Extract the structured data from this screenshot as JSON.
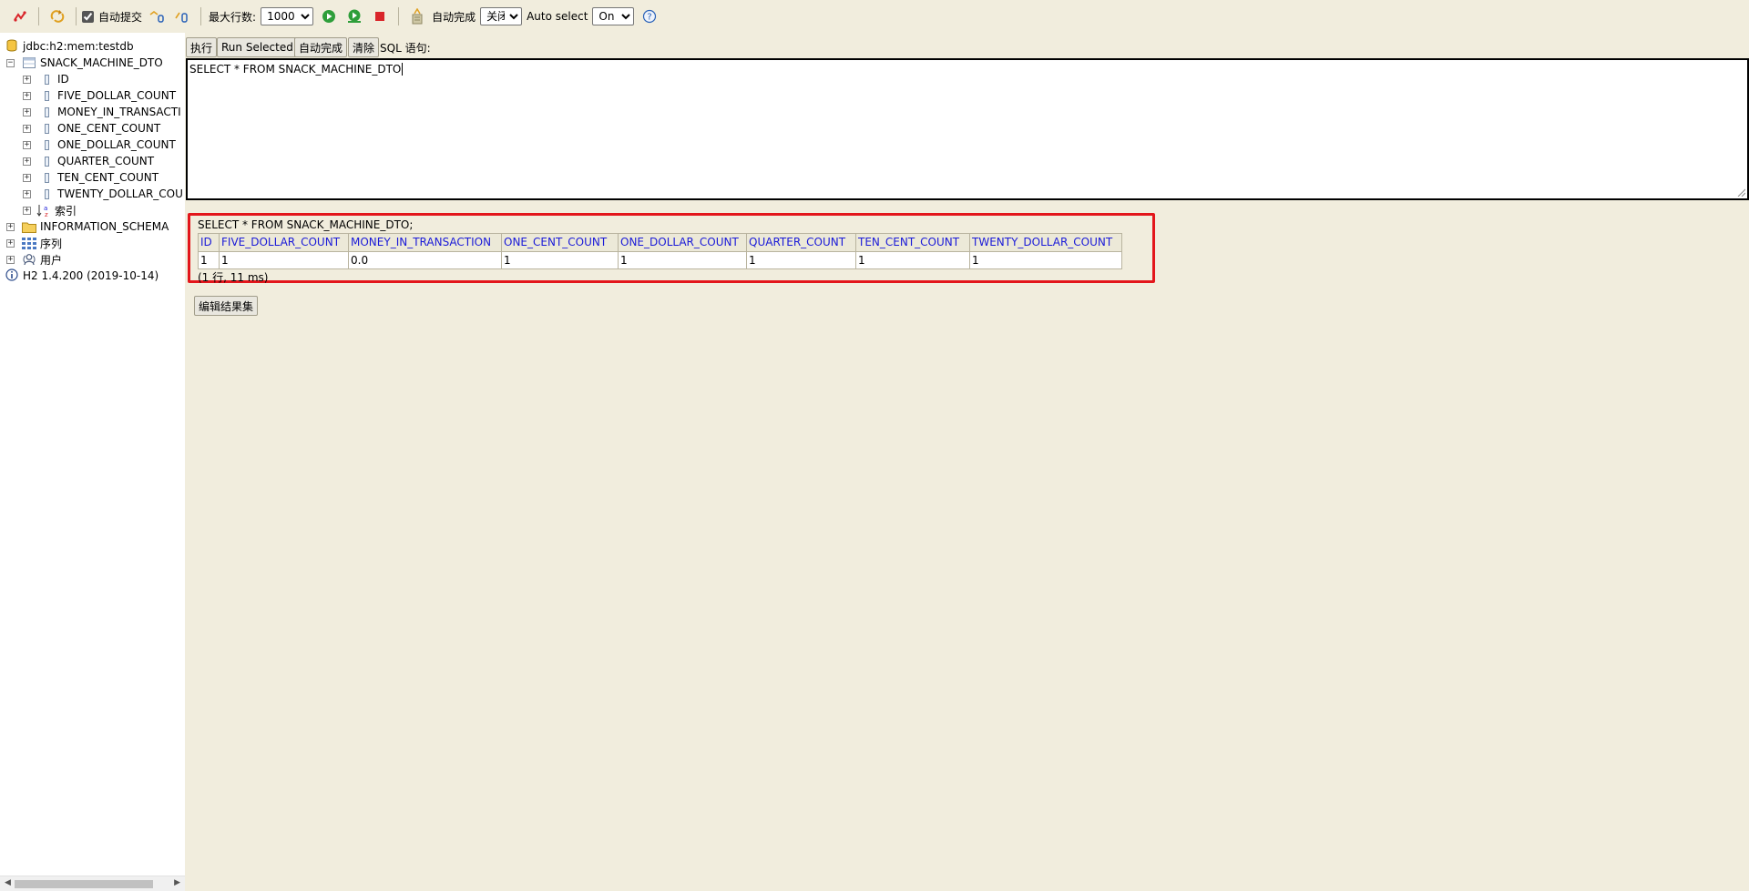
{
  "toolbar": {
    "auto_commit_label": "自动提交",
    "max_rows_label": "最大行数:",
    "max_rows_value": "1000",
    "auto_complete_label": "自动完成",
    "auto_complete_value": "关闭",
    "auto_select_label": "Auto select",
    "auto_select_value": "On",
    "help_glyph": "?"
  },
  "sidebar": {
    "connection": "jdbc:h2:mem:testdb",
    "table_name": "SNACK_MACHINE_DTO",
    "columns": [
      "ID",
      "FIVE_DOLLAR_COUNT",
      "MONEY_IN_TRANSACTI",
      "ONE_CENT_COUNT",
      "ONE_DOLLAR_COUNT",
      "QUARTER_COUNT",
      "TEN_CENT_COUNT",
      "TWENTY_DOLLAR_COU"
    ],
    "indexes_label": "索引",
    "information_schema": "INFORMATION_SCHEMA",
    "sequences_label": "序列",
    "users_label": "用户",
    "version": "H2 1.4.200 (2019-10-14)"
  },
  "sql_panel": {
    "run_button": "执行",
    "run_selected_button": "Run Selected",
    "auto_complete_button": "自动完成",
    "clear_button": "清除",
    "sql_label": "SQL 语句:",
    "sql_text": "SELECT * FROM SNACK_MACHINE_DTO"
  },
  "result": {
    "query": "SELECT * FROM SNACK_MACHINE_DTO;",
    "headers": [
      "ID",
      "FIVE_DOLLAR_COUNT",
      "MONEY_IN_TRANSACTION",
      "ONE_CENT_COUNT",
      "ONE_DOLLAR_COUNT",
      "QUARTER_COUNT",
      "TEN_CENT_COUNT",
      "TWENTY_DOLLAR_COUNT"
    ],
    "rows": [
      [
        "1",
        "1",
        "0.0",
        "1",
        "1",
        "1",
        "1",
        "1"
      ]
    ],
    "meta": "(1 行, 11 ms)",
    "edit_button": "编辑结果集"
  },
  "colors": {
    "highlight_border": "#e3161b",
    "header_text": "#1a1ad8",
    "background": "#f1eddd"
  }
}
